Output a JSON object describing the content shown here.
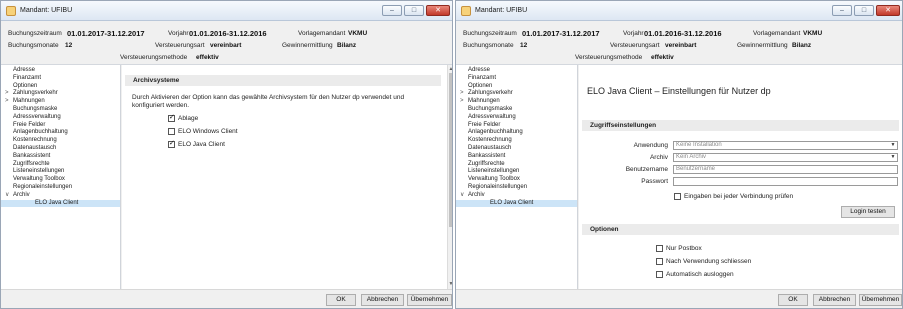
{
  "left": {
    "title": "Mandant: UFIBU",
    "info": {
      "buchungszeitraum_label": "Buchungszeitraum",
      "buchungszeitraum_value": "01.01.2017-31.12.2017",
      "vorjahr_label": "Vorjahr",
      "vorjahr_value": "01.01.2016-31.12.2016",
      "vorlagemandant_label": "Vorlagemandant",
      "vorlagemandant_value": "VKMU",
      "buchungsmonate_label": "Buchungsmonate",
      "buchungsmonate_value": "12",
      "versteuerungsart_label": "Versteuerungsart",
      "versteuerungsart_value": "vereinbart",
      "gewinnermittlung_label": "Gewinnermittlung",
      "gewinnermittlung_value": "Bilanz",
      "versteuerungsmethode_label": "Versteuerungsmethode",
      "versteuerungsmethode_value": "effektiv"
    },
    "nav": [
      {
        "label": "Adresse"
      },
      {
        "label": "Finanzamt"
      },
      {
        "label": "Optionen"
      },
      {
        "label": "Zahlungsverkehr",
        "chev": ">"
      },
      {
        "label": "Mahnungen",
        "chev": ">"
      },
      {
        "label": "Buchungsmaske"
      },
      {
        "label": "Adressverwaltung"
      },
      {
        "label": "Freie Felder"
      },
      {
        "label": "Anlagenbuchhaltung"
      },
      {
        "label": "Kostenrechnung"
      },
      {
        "label": "Datenaustausch"
      },
      {
        "label": "Bankassistent"
      },
      {
        "label": "Zugriffsrechte"
      },
      {
        "label": "Listeneinstellungen"
      },
      {
        "label": "Verwaltung Toolbox"
      },
      {
        "label": "Regionaleinstellungen"
      },
      {
        "label": "Archiv",
        "chev": "∨"
      },
      {
        "label": "ELO Java Client",
        "child": true,
        "selected": true
      }
    ],
    "section_title": "Archivsysteme",
    "description": "Durch Aktivieren der Option kann das gewählte Archivsystem für den Nutzer dp verwendet und konfiguriert werden.",
    "options": [
      {
        "label": "Ablage",
        "checked": true
      },
      {
        "label": "ELO Windows Client",
        "checked": false
      },
      {
        "label": "ELO Java Client",
        "checked": true
      }
    ],
    "buttons": {
      "ok": "OK",
      "cancel": "Abbrechen",
      "apply": "Übernehmen"
    }
  },
  "right": {
    "title": "Mandant: UFIBU",
    "info": {
      "buchungszeitraum_label": "Buchungszeitraum",
      "buchungszeitraum_value": "01.01.2017-31.12.2017",
      "vorjahr_label": "Vorjahr",
      "vorjahr_value": "01.01.2016-31.12.2016",
      "vorlagemandant_label": "Vorlagemandant",
      "vorlagemandant_value": "VKMU",
      "buchungsmonate_label": "Buchungsmonate",
      "buchungsmonate_value": "12",
      "versteuerungsart_label": "Versteuerungsart",
      "versteuerungsart_value": "vereinbart",
      "gewinnermittlung_label": "Gewinnermittlung",
      "gewinnermittlung_value": "Bilanz",
      "versteuerungsmethode_label": "Versteuerungsmethode",
      "versteuerungsmethode_value": "effektiv"
    },
    "nav": [
      {
        "label": "Adresse"
      },
      {
        "label": "Finanzamt"
      },
      {
        "label": "Optionen"
      },
      {
        "label": "Zahlungsverkehr",
        "chev": ">"
      },
      {
        "label": "Mahnungen",
        "chev": ">"
      },
      {
        "label": "Buchungsmaske"
      },
      {
        "label": "Adressverwaltung"
      },
      {
        "label": "Freie Felder"
      },
      {
        "label": "Anlagenbuchhaltung"
      },
      {
        "label": "Kostenrechnung"
      },
      {
        "label": "Datenaustausch"
      },
      {
        "label": "Bankassistent"
      },
      {
        "label": "Zugriffsrechte"
      },
      {
        "label": "Listeneinstellungen"
      },
      {
        "label": "Verwaltung Toolbox"
      },
      {
        "label": "Regionaleinstellungen"
      },
      {
        "label": "Archiv",
        "chev": "∨"
      },
      {
        "label": "ELO Java Client",
        "child": true,
        "selected": true
      }
    ],
    "heading": "ELO Java Client – Einstellungen für Nutzer dp",
    "access_section": "Zugriffseinstellungen",
    "fields": {
      "anwendung_label": "Anwendung",
      "anwendung_value": "Keine Installation",
      "archiv_label": "Archiv",
      "archiv_value": "Kein Archiv",
      "benutzername_label": "Benutzername",
      "benutzername_placeholder": "Benutzername",
      "passwort_label": "Passwort"
    },
    "verify_label": "Eingaben bei jeder Verbindung prüfen",
    "login_test": "Login testen",
    "options_section": "Optionen",
    "options": [
      {
        "label": "Nur Postbox",
        "checked": false
      },
      {
        "label": "Nach Verwendung schliessen",
        "checked": false
      },
      {
        "label": "Automatisch ausloggen",
        "checked": false
      }
    ],
    "buttons": {
      "ok": "OK",
      "cancel": "Abbrechen",
      "apply": "Übernehmen"
    }
  }
}
